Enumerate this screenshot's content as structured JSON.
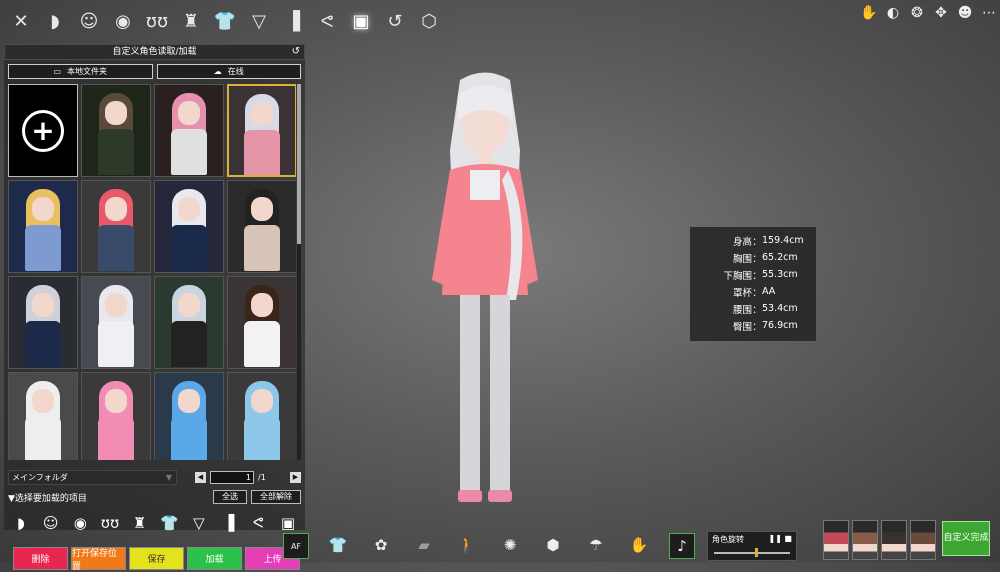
{
  "top_toolbar": {
    "icons": [
      "close-icon",
      "hair-icon",
      "face-icon",
      "eye-icon",
      "breast-icon",
      "torso-icon",
      "shirt-icon",
      "bikini-icon",
      "sock-icon",
      "bunny-ears-icon",
      "save-card-icon",
      "undo-icon",
      "cube-icon"
    ]
  },
  "top_right_icons": [
    "hand-icon",
    "move-view-icon",
    "camera-effect-icon",
    "move-arrows-icon",
    "character-icon",
    "more-icon"
  ],
  "panel": {
    "title": "自定义角色读取/加载",
    "local_folder": "本地文件夹",
    "online": "在线",
    "folder": "メインフォルダ",
    "page_current": "1",
    "page_total": "/1",
    "section_label": "▼选择要加载的项目",
    "select_all": "全选",
    "deselect_all": "全部解除",
    "category_icons": [
      "hair-icon",
      "face-icon",
      "eye-icon",
      "breast-icon",
      "torso-icon",
      "shirt-icon",
      "bikini-icon",
      "sock-icon",
      "bunny-ears-icon",
      "save-card-icon"
    ],
    "actions": [
      {
        "label": "删除",
        "color": "#e8274f"
      },
      {
        "label": "打开保存位置",
        "color": "#f07a17"
      },
      {
        "label": "保存",
        "color": "#e4e21c"
      },
      {
        "label": "加载",
        "color": "#2cc14a"
      },
      {
        "label": "上传",
        "color": "#e53fb8"
      }
    ]
  },
  "cards": [
    {
      "type": "add"
    },
    {
      "hair": "#5a4a3a",
      "outfit": "#2d3a2a",
      "bg": "#1d2618"
    },
    {
      "hair": "#e68fae",
      "outfit": "#e0e0e0",
      "bg": "#2a2020"
    },
    {
      "hair": "#d9d9e6",
      "outfit": "#e695a8",
      "bg": "#3a3234",
      "selected": true
    },
    {
      "hair": "#e8c060",
      "outfit": "#7d9bd0",
      "bg": "#1d2a4a"
    },
    {
      "hair": "#e85a6a",
      "outfit": "#3a4a6a",
      "bg": "#3a3a3a"
    },
    {
      "hair": "#e8e8ee",
      "outfit": "#1a2a4a",
      "bg": "#24283a"
    },
    {
      "hair": "#222222",
      "outfit": "#d8c4b6",
      "bg": "#2a2a2a"
    },
    {
      "hair": "#d0d0d8",
      "outfit": "#1c2a4a",
      "bg": "#2a2c34"
    },
    {
      "hair": "#e8e8ee",
      "outfit": "#f0f0f4",
      "bg": "#474a50"
    },
    {
      "hair": "#c8d4e0",
      "outfit": "#222222",
      "bg": "#2a3a30"
    },
    {
      "hair": "#3a2618",
      "outfit": "#f2f2f4",
      "bg": "#3a3434"
    },
    {
      "hair": "#eeeeee",
      "outfit": "#eeeeee",
      "bg": "#4a4a4a"
    },
    {
      "hair": "#f28cb4",
      "outfit": "#f28cb4",
      "bg": "#3a3a3a"
    },
    {
      "hair": "#5aa8e8",
      "outfit": "#5aa8e8",
      "bg": "#2a3a4a"
    },
    {
      "hair": "#8ec8e8",
      "outfit": "#8ec8e8",
      "bg": "#3a3a3a"
    }
  ],
  "measurements": [
    {
      "label": "身高",
      "value": "159.4cm"
    },
    {
      "label": "胸围",
      "value": "65.2cm"
    },
    {
      "label": "下胸围",
      "value": "55.3cm"
    },
    {
      "label": "罩杯",
      "value": "AA"
    },
    {
      "label": "腰围",
      "value": "53.4cm"
    },
    {
      "label": "臀围",
      "value": "76.9cm"
    }
  ],
  "bottom_bar": {
    "icons": [
      "autofocus-icon",
      "outfit-icon",
      "accessory-icon",
      "texture-icon",
      "pose-icon",
      "splash-icon",
      "box-icon",
      "light-icon",
      "gesture-icon",
      "music-icon"
    ],
    "af_label": "AF",
    "rotation_label": "角色旋转",
    "rotation_controls": "❚❚  ■",
    "rotation_level": 0.55,
    "done_label": "自定义完成",
    "avatar_colors": [
      "#c24a5a",
      "#8a5a4a",
      "#3a3030",
      "#6a4a3a"
    ]
  }
}
